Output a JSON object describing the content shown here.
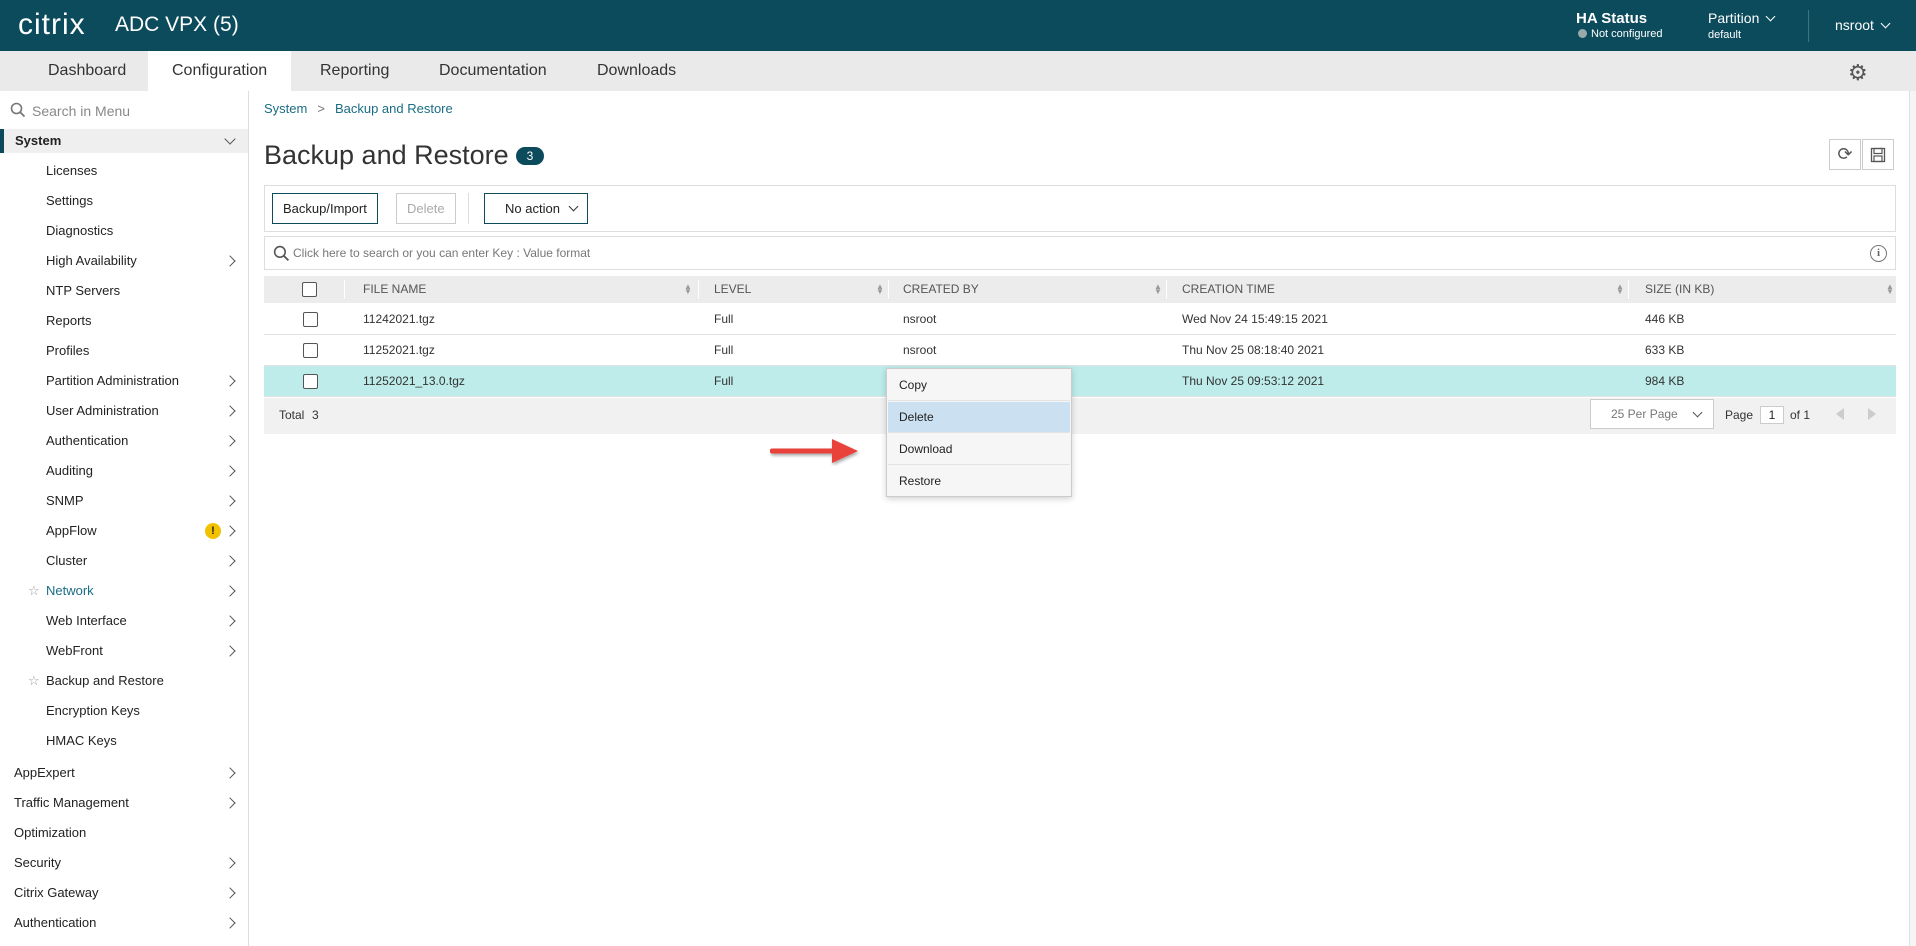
{
  "header": {
    "logo": "citrix",
    "product": "ADC VPX (5)",
    "ha_status_title": "HA Status",
    "ha_status_value": "Not configured",
    "partition_title": "Partition",
    "partition_value": "default",
    "user": "nsroot",
    "brand_color": "#0b4b5c"
  },
  "tabs": [
    "Dashboard",
    "Configuration",
    "Reporting",
    "Documentation",
    "Downloads"
  ],
  "active_tab": "Configuration",
  "sidebar": {
    "search_placeholder": "Search in Menu",
    "section": "System",
    "sub_items": [
      "Licenses",
      "Settings",
      "Diagnostics",
      "High Availability",
      "NTP Servers",
      "Reports",
      "Profiles",
      "Partition Administration",
      "User Administration",
      "Authentication",
      "Auditing",
      "SNMP",
      "AppFlow",
      "Cluster",
      "Network",
      "Web Interface",
      "WebFront",
      "Backup and Restore",
      "Encryption Keys",
      "HMAC Keys"
    ],
    "warning_badge": "!",
    "top_items": [
      "AppExpert",
      "Traffic Management",
      "Optimization",
      "Security",
      "Citrix Gateway",
      "Authentication"
    ]
  },
  "breadcrumb": {
    "root": "System",
    "current": "Backup and Restore"
  },
  "page": {
    "title": "Backup and Restore",
    "count": "3"
  },
  "toolbar": {
    "backup_label": "Backup/Import",
    "delete_label": "Delete",
    "action_label": "No action"
  },
  "search": {
    "placeholder": "Click here to search or you can enter Key : Value format",
    "info_icon": "i"
  },
  "table": {
    "columns": [
      "FILE NAME",
      "LEVEL",
      "CREATED BY",
      "CREATION TIME",
      "SIZE (IN KB)"
    ],
    "rows": [
      [
        "11242021.tgz",
        "Full",
        "nsroot",
        "Wed Nov 24 15:49:15 2021",
        "446 KB"
      ],
      [
        "11252021.tgz",
        "Full",
        "nsroot",
        "Thu Nov 25 08:18:40 2021",
        "633 KB"
      ],
      [
        "11252021_13.0.tgz",
        "Full",
        "",
        "Thu Nov 25 09:53:12 2021",
        "984 KB"
      ]
    ],
    "selected_row": 2,
    "total_label": "Total",
    "total_value": "3",
    "per_page": "25 Per Page",
    "page_label": "Page",
    "page_value": "1",
    "of_label": "of 1"
  },
  "context_menu": {
    "items": [
      "Copy",
      "Delete",
      "Download",
      "Restore"
    ],
    "highlighted": "Delete"
  },
  "colors": {
    "selected_row": "#bdecea",
    "menu_highlight": "#cbe0f1",
    "annotation_arrow": "#e8423b"
  }
}
